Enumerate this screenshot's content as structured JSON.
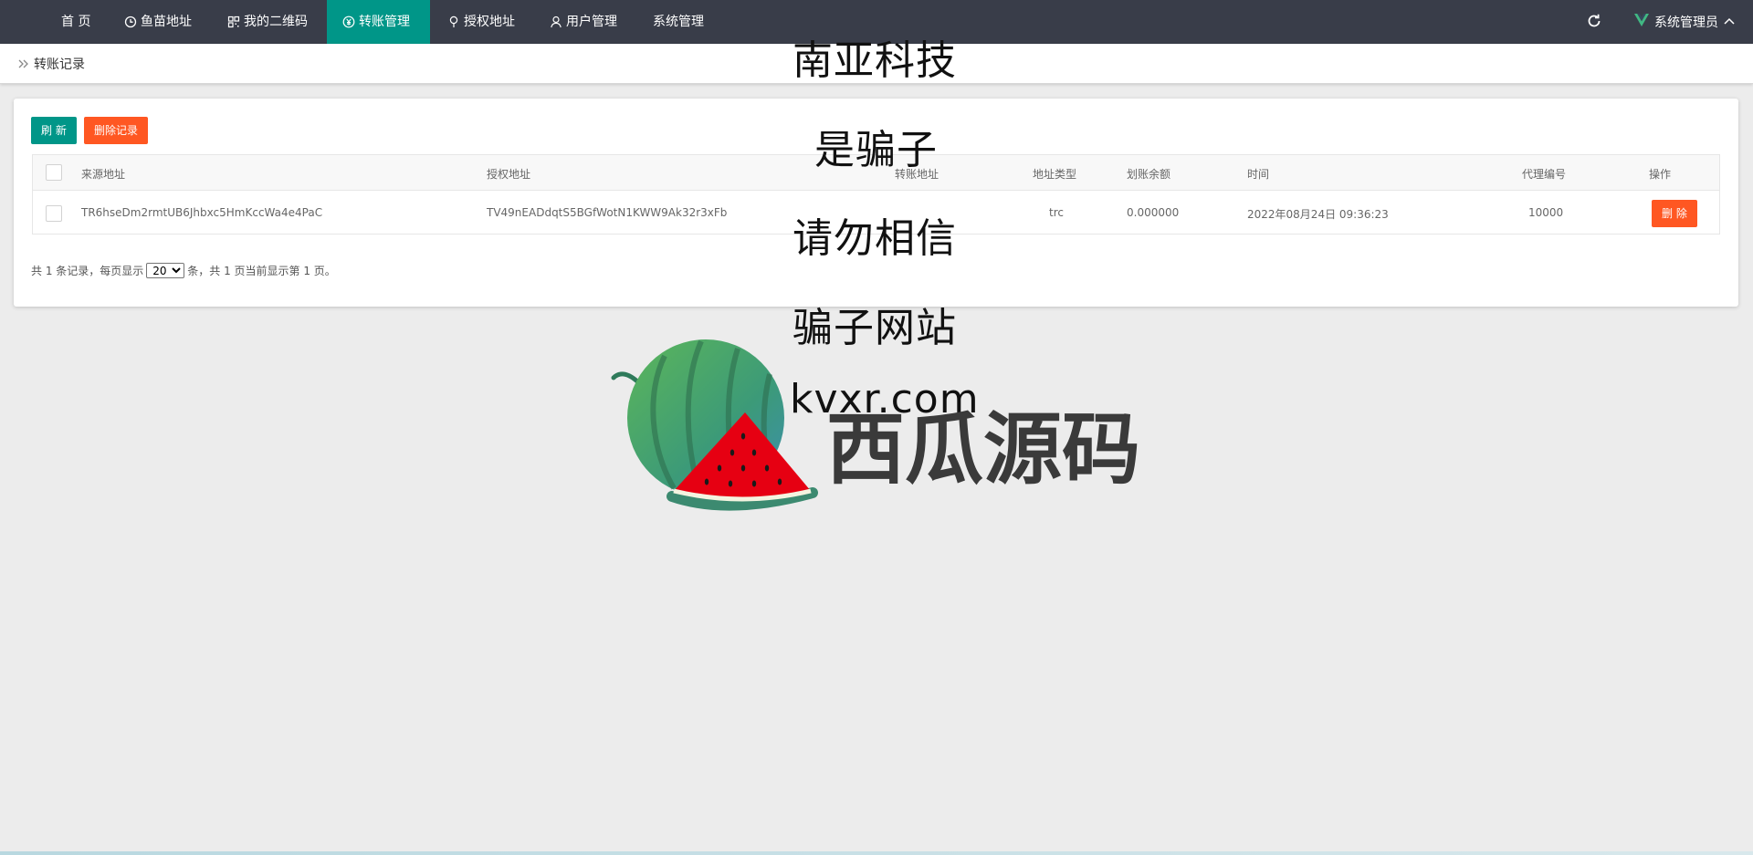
{
  "nav": {
    "items": [
      {
        "label": "首 页",
        "icon": "home"
      },
      {
        "label": "鱼苗地址",
        "icon": "clock-icon"
      },
      {
        "label": "我的二维码",
        "icon": "qrcode-icon"
      },
      {
        "label": "转账管理",
        "icon": "yen-icon",
        "active": true
      },
      {
        "label": "授权地址",
        "icon": "pin-icon"
      },
      {
        "label": "用户管理",
        "icon": "user-icon"
      },
      {
        "label": "系统管理",
        "icon": "none"
      }
    ],
    "user_label": "系统管理员",
    "accent": "#009688"
  },
  "breadcrumb": {
    "label": "转账记录"
  },
  "toolbar": {
    "refresh_label": "刷 新",
    "delete_records_label": "删除记录"
  },
  "table": {
    "columns": [
      "来源地址",
      "授权地址",
      "转账地址",
      "地址类型",
      "划账余额",
      "时间",
      "代理编号",
      "操作"
    ],
    "rows": [
      {
        "source": "TR6hseDm2rmtUB6Jhbxc5HmKccWa4e4PaC",
        "auth": "TV49nEADdqtS5BGfWotN1KWW9Ak32r3xFb",
        "transfer": "",
        "type": "trc",
        "balance": "0.000000",
        "time": "2022年08月24日 09:36:23",
        "agent": "10000",
        "action": "删 除"
      }
    ]
  },
  "pager": {
    "prefix": "共 1 条记录，每页显示",
    "page_size": "20",
    "suffix": "条，共 1 页当前显示第 1 页。"
  },
  "watermark": {
    "lines": [
      "南亚科技",
      "是骗子",
      "请勿相信",
      "骗子网站",
      "kvxr.com"
    ],
    "brand": "西瓜源码"
  },
  "colors": {
    "topbar": "#393d49",
    "teal": "#009688",
    "orange": "#ff5722"
  }
}
